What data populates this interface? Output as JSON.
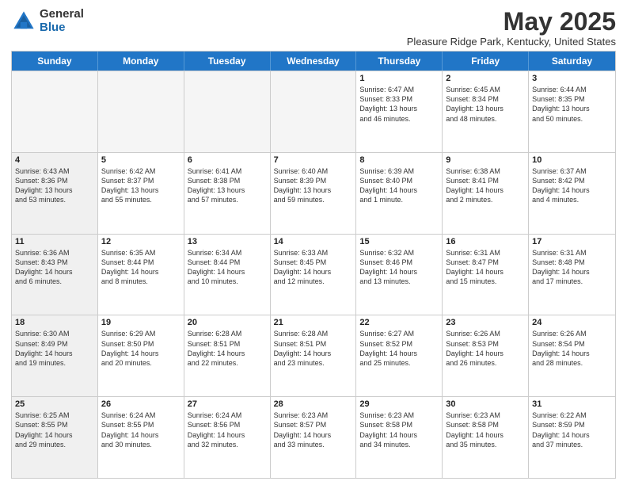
{
  "logo": {
    "general": "General",
    "blue": "Blue"
  },
  "title": "May 2025",
  "subtitle": "Pleasure Ridge Park, Kentucky, United States",
  "headers": [
    "Sunday",
    "Monday",
    "Tuesday",
    "Wednesday",
    "Thursday",
    "Friday",
    "Saturday"
  ],
  "weeks": [
    [
      {
        "day": "",
        "info": "",
        "shaded": true
      },
      {
        "day": "",
        "info": "",
        "shaded": true
      },
      {
        "day": "",
        "info": "",
        "shaded": true
      },
      {
        "day": "",
        "info": "",
        "shaded": true
      },
      {
        "day": "1",
        "info": "Sunrise: 6:47 AM\nSunset: 8:33 PM\nDaylight: 13 hours\nand 46 minutes.",
        "shaded": false
      },
      {
        "day": "2",
        "info": "Sunrise: 6:45 AM\nSunset: 8:34 PM\nDaylight: 13 hours\nand 48 minutes.",
        "shaded": false
      },
      {
        "day": "3",
        "info": "Sunrise: 6:44 AM\nSunset: 8:35 PM\nDaylight: 13 hours\nand 50 minutes.",
        "shaded": false
      }
    ],
    [
      {
        "day": "4",
        "info": "Sunrise: 6:43 AM\nSunset: 8:36 PM\nDaylight: 13 hours\nand 53 minutes.",
        "shaded": true
      },
      {
        "day": "5",
        "info": "Sunrise: 6:42 AM\nSunset: 8:37 PM\nDaylight: 13 hours\nand 55 minutes.",
        "shaded": false
      },
      {
        "day": "6",
        "info": "Sunrise: 6:41 AM\nSunset: 8:38 PM\nDaylight: 13 hours\nand 57 minutes.",
        "shaded": false
      },
      {
        "day": "7",
        "info": "Sunrise: 6:40 AM\nSunset: 8:39 PM\nDaylight: 13 hours\nand 59 minutes.",
        "shaded": false
      },
      {
        "day": "8",
        "info": "Sunrise: 6:39 AM\nSunset: 8:40 PM\nDaylight: 14 hours\nand 1 minute.",
        "shaded": false
      },
      {
        "day": "9",
        "info": "Sunrise: 6:38 AM\nSunset: 8:41 PM\nDaylight: 14 hours\nand 2 minutes.",
        "shaded": false
      },
      {
        "day": "10",
        "info": "Sunrise: 6:37 AM\nSunset: 8:42 PM\nDaylight: 14 hours\nand 4 minutes.",
        "shaded": false
      }
    ],
    [
      {
        "day": "11",
        "info": "Sunrise: 6:36 AM\nSunset: 8:43 PM\nDaylight: 14 hours\nand 6 minutes.",
        "shaded": true
      },
      {
        "day": "12",
        "info": "Sunrise: 6:35 AM\nSunset: 8:44 PM\nDaylight: 14 hours\nand 8 minutes.",
        "shaded": false
      },
      {
        "day": "13",
        "info": "Sunrise: 6:34 AM\nSunset: 8:44 PM\nDaylight: 14 hours\nand 10 minutes.",
        "shaded": false
      },
      {
        "day": "14",
        "info": "Sunrise: 6:33 AM\nSunset: 8:45 PM\nDaylight: 14 hours\nand 12 minutes.",
        "shaded": false
      },
      {
        "day": "15",
        "info": "Sunrise: 6:32 AM\nSunset: 8:46 PM\nDaylight: 14 hours\nand 13 minutes.",
        "shaded": false
      },
      {
        "day": "16",
        "info": "Sunrise: 6:31 AM\nSunset: 8:47 PM\nDaylight: 14 hours\nand 15 minutes.",
        "shaded": false
      },
      {
        "day": "17",
        "info": "Sunrise: 6:31 AM\nSunset: 8:48 PM\nDaylight: 14 hours\nand 17 minutes.",
        "shaded": false
      }
    ],
    [
      {
        "day": "18",
        "info": "Sunrise: 6:30 AM\nSunset: 8:49 PM\nDaylight: 14 hours\nand 19 minutes.",
        "shaded": true
      },
      {
        "day": "19",
        "info": "Sunrise: 6:29 AM\nSunset: 8:50 PM\nDaylight: 14 hours\nand 20 minutes.",
        "shaded": false
      },
      {
        "day": "20",
        "info": "Sunrise: 6:28 AM\nSunset: 8:51 PM\nDaylight: 14 hours\nand 22 minutes.",
        "shaded": false
      },
      {
        "day": "21",
        "info": "Sunrise: 6:28 AM\nSunset: 8:51 PM\nDaylight: 14 hours\nand 23 minutes.",
        "shaded": false
      },
      {
        "day": "22",
        "info": "Sunrise: 6:27 AM\nSunset: 8:52 PM\nDaylight: 14 hours\nand 25 minutes.",
        "shaded": false
      },
      {
        "day": "23",
        "info": "Sunrise: 6:26 AM\nSunset: 8:53 PM\nDaylight: 14 hours\nand 26 minutes.",
        "shaded": false
      },
      {
        "day": "24",
        "info": "Sunrise: 6:26 AM\nSunset: 8:54 PM\nDaylight: 14 hours\nand 28 minutes.",
        "shaded": false
      }
    ],
    [
      {
        "day": "25",
        "info": "Sunrise: 6:25 AM\nSunset: 8:55 PM\nDaylight: 14 hours\nand 29 minutes.",
        "shaded": true
      },
      {
        "day": "26",
        "info": "Sunrise: 6:24 AM\nSunset: 8:55 PM\nDaylight: 14 hours\nand 30 minutes.",
        "shaded": false
      },
      {
        "day": "27",
        "info": "Sunrise: 6:24 AM\nSunset: 8:56 PM\nDaylight: 14 hours\nand 32 minutes.",
        "shaded": false
      },
      {
        "day": "28",
        "info": "Sunrise: 6:23 AM\nSunset: 8:57 PM\nDaylight: 14 hours\nand 33 minutes.",
        "shaded": false
      },
      {
        "day": "29",
        "info": "Sunrise: 6:23 AM\nSunset: 8:58 PM\nDaylight: 14 hours\nand 34 minutes.",
        "shaded": false
      },
      {
        "day": "30",
        "info": "Sunrise: 6:23 AM\nSunset: 8:58 PM\nDaylight: 14 hours\nand 35 minutes.",
        "shaded": false
      },
      {
        "day": "31",
        "info": "Sunrise: 6:22 AM\nSunset: 8:59 PM\nDaylight: 14 hours\nand 37 minutes.",
        "shaded": false
      }
    ]
  ]
}
